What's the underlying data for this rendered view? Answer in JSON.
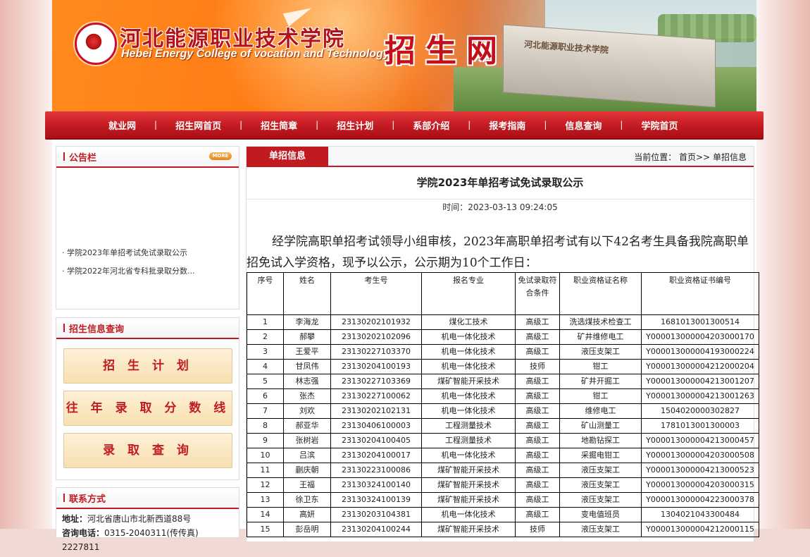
{
  "header": {
    "college_cn": "河北能源职业技术学院",
    "college_en": "Hebei Energy College of vocation and Technology",
    "site_title": "招生网",
    "building_sign": "河北能源职业技术学院"
  },
  "nav": [
    "就业网",
    "招生网首页",
    "招生简章",
    "招生计划",
    "系部介绍",
    "报考指南",
    "信息查询",
    "学院首页"
  ],
  "nav_separator": "|",
  "notice": {
    "title": "公告栏",
    "more": "MORE",
    "items": [
      "学院2023年单招考试免试录取公示",
      "学院2022年河北省专科批录取分数..."
    ]
  },
  "query": {
    "title": "招生信息查询",
    "buttons": [
      "招 生 计 划",
      "往 年 录 取 分 数 线",
      "录 取 查 询"
    ]
  },
  "contact": {
    "title": "联系方式",
    "address_label": "地址：",
    "address": "河北省唐山市北新西道88号",
    "phone_label": "咨询电话：",
    "phone": "0315-2040311(传传真) 2227811"
  },
  "main": {
    "tab": "单招信息",
    "breadcrumb_label": "当前位置：",
    "breadcrumb_home": "首页>>",
    "breadcrumb_current": "单招信息",
    "title": "学院2023年单招考试免试录取公示",
    "time_label": "时间：",
    "time": "2023-03-13 09:24:05",
    "paragraph": "经学院高职单招考试领导小组审核，2023年高职单招考试有以下42名考生具备我院高职单招免试入学资格，现予以公示，公示期为10个工作日："
  },
  "table": {
    "headers": [
      "序号",
      "姓名",
      "考生号",
      "报名专业",
      "免试录取符合条件",
      "职业资格证名称",
      "职业资格证书编号"
    ],
    "rows": [
      [
        "1",
        "李海龙",
        "23130202101932",
        "煤化工技术",
        "高级工",
        "洗选煤技术检查工",
        "1681013001300514"
      ],
      [
        "2",
        "郝攀",
        "23130202102096",
        "机电一体化技术",
        "高级工",
        "矿井维修电工",
        "Y000013000004203000170"
      ],
      [
        "3",
        "王爱平",
        "23130227103370",
        "机电一体化技术",
        "高级工",
        "液压支架工",
        "Y000013000004193000224"
      ],
      [
        "4",
        "甘凤伟",
        "23130204100193",
        "机电一体化技术",
        "技师",
        "钳工",
        "Y000013000004212000204"
      ],
      [
        "5",
        "林志强",
        "23130227103369",
        "煤矿智能开采技术",
        "高级工",
        "矿井开掘工",
        "Y000013000004213001207"
      ],
      [
        "6",
        "张杰",
        "23130227100062",
        "机电一体化技术",
        "高级工",
        "钳工",
        "Y000013000004213001263"
      ],
      [
        "7",
        "刘欢",
        "23130202102131",
        "机电一体化技术",
        "高级工",
        "维修电工",
        "1504020000302827"
      ],
      [
        "8",
        "郝亚华",
        "23130406100003",
        "工程测量技术",
        "高级工",
        "矿山测量工",
        "1781013001300003"
      ],
      [
        "9",
        "张树岩",
        "23130204100405",
        "工程测量技术",
        "高级工",
        "地勘钻探工",
        "Y000013000004213000457"
      ],
      [
        "10",
        "吕滨",
        "23130204100017",
        "机电一体化技术",
        "高级工",
        "采掘电钳工",
        "Y000013000004203000508"
      ],
      [
        "11",
        "蒯庆朝",
        "23130223100086",
        "煤矿智能开采技术",
        "高级工",
        "液压支架工",
        "Y000013000004213000523"
      ],
      [
        "12",
        "王福",
        "23130324100140",
        "煤矿智能开采技术",
        "高级工",
        "液压支架工",
        "Y000013000004203000315"
      ],
      [
        "13",
        "徐卫东",
        "23130324100139",
        "煤矿智能开采技术",
        "高级工",
        "液压支架工",
        "Y000013000004223000378"
      ],
      [
        "14",
        "高妍",
        "23130203104381",
        "机电一体化技术",
        "高级工",
        "变电值班员",
        "1304021043300484"
      ],
      [
        "15",
        "彭岳明",
        "23130204100244",
        "煤矿智能开采技术",
        "技师",
        "液压支架工",
        "Y000013000004212000115"
      ]
    ]
  }
}
